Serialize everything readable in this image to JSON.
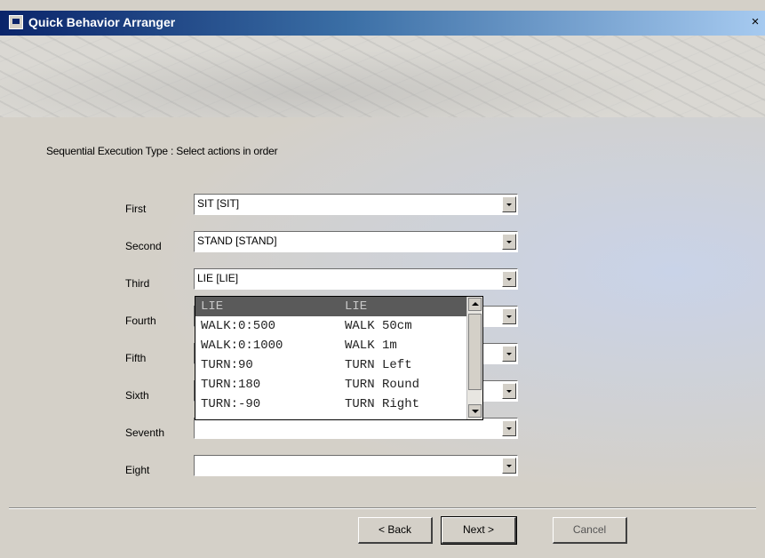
{
  "window": {
    "title": "Quick Behavior Arranger",
    "close_glyph": "×"
  },
  "instruction": "Sequential Execution Type : Select actions in order",
  "rows": [
    {
      "label": "First",
      "value": "SIT [SIT]"
    },
    {
      "label": "Second",
      "value": "STAND [STAND]"
    },
    {
      "label": "Third",
      "value": "LIE [LIE]"
    },
    {
      "label": "Fourth",
      "value": ""
    },
    {
      "label": "Fifth",
      "value": ""
    },
    {
      "label": "Sixth",
      "value": ""
    },
    {
      "label": "Seventh",
      "value": ""
    },
    {
      "label": "Eight",
      "value": ""
    }
  ],
  "dropdown": {
    "items": [
      {
        "code": "LIE",
        "name": "LIE",
        "selected": true
      },
      {
        "code": "WALK:0:500",
        "name": "WALK 50cm"
      },
      {
        "code": "WALK:0:1000",
        "name": "WALK 1m"
      },
      {
        "code": "TURN:90",
        "name": "TURN Left"
      },
      {
        "code": "TURN:180",
        "name": "TURN Round"
      },
      {
        "code": "TURN:-90",
        "name": "TURN Right"
      }
    ]
  },
  "buttons": {
    "back": "< Back",
    "next": "Next >",
    "cancel": "Cancel"
  },
  "icons": {
    "window": "window-icon",
    "close": "close-icon",
    "combo_arrow": "chevron-down-icon"
  },
  "colors": {
    "titlebar_start": "#0a246a",
    "titlebar_end": "#a6caf0",
    "dialog_bg": "#d4d0c8",
    "selection": "#5a5a5a"
  }
}
